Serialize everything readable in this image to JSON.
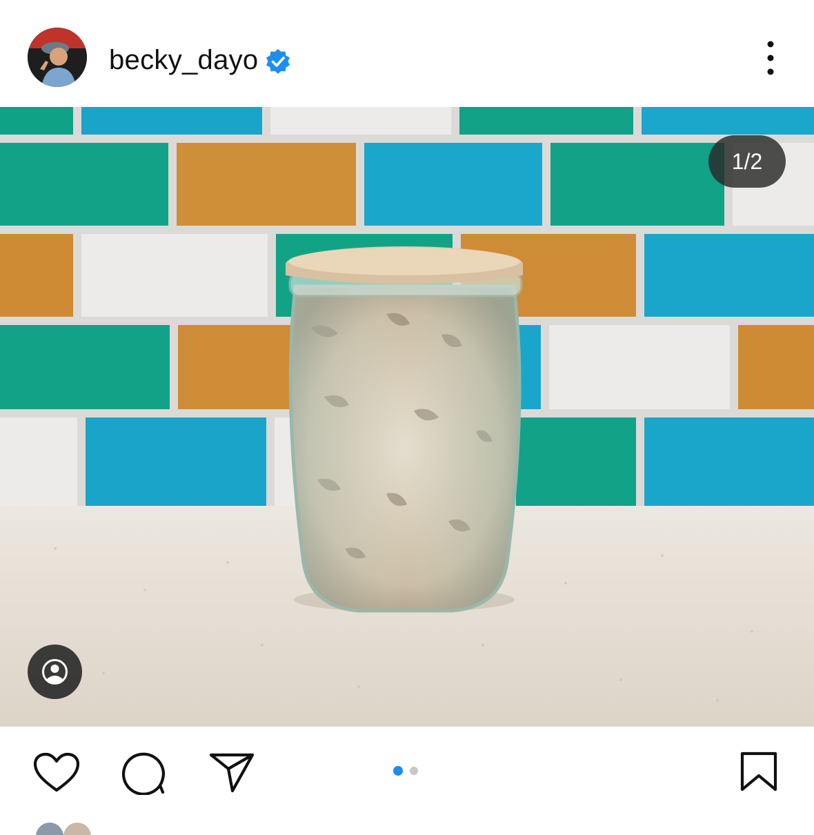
{
  "header": {
    "username": "becky_dayo",
    "verified": true,
    "avatar_icon": "profile-photo",
    "more_icon": "vertical-ellipsis-icon"
  },
  "post": {
    "counter": "1/2",
    "tag_icon": "user-tag-icon"
  },
  "actions": {
    "like_icon": "heart-icon",
    "comment_icon": "comment-bubble-icon",
    "share_icon": "send-paper-plane-icon",
    "save_icon": "bookmark-icon",
    "carousel": {
      "total": 2,
      "active_index": 0
    }
  },
  "colors": {
    "accent_blue": "#1d8ef0",
    "dot_inactive": "#c8c8c8",
    "overlay": "#282828",
    "tile_green": "#11a287",
    "tile_blue": "#1aa4c9",
    "tile_orange": "#cf8f38",
    "tile_white": "#ecebea"
  }
}
